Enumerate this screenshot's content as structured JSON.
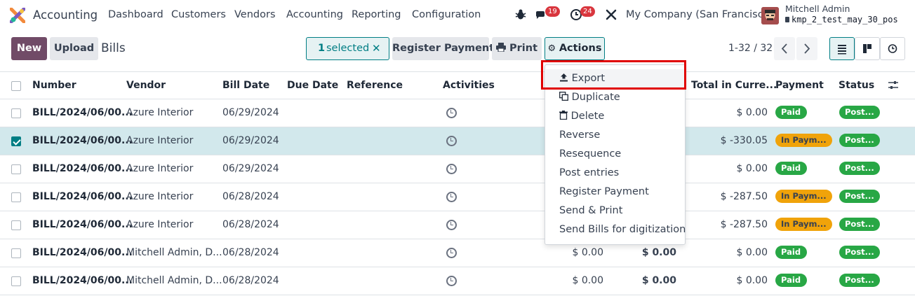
{
  "app": {
    "name": "Accounting"
  },
  "nav": {
    "menu": [
      "Dashboard",
      "Customers",
      "Vendors",
      "Accounting",
      "Reporting",
      "Configuration"
    ],
    "messages_badge": "19",
    "activities_badge": "24",
    "company": "My Company (San Francisco)",
    "user_name": "Mitchell Admin",
    "db_name": "kmp_2_test_may_30_pos"
  },
  "control": {
    "new_label": "New",
    "upload_label": "Upload",
    "breadcrumb": "Bills",
    "selected_count": "1",
    "selected_text": "selected",
    "register_payment_label": "Register Payment",
    "print_label": "Print",
    "actions_label": "Actions",
    "pager": "1-32 / 32"
  },
  "table": {
    "headers": {
      "number": "Number",
      "vendor": "Vendor",
      "bill_date": "Bill Date",
      "due_date": "Due Date",
      "reference": "Reference",
      "activities": "Activities",
      "total_currency": "Total in Curre...",
      "payment": "Payment",
      "status": "Status"
    },
    "rows": [
      {
        "number": "BILL/2024/06/00...",
        "vendor": "Azure Interior",
        "date": "06/29/2024",
        "tax": "",
        "total": "",
        "total_cur": "$ 0.00",
        "payment": "Paid",
        "status": "Post..."
      },
      {
        "number": "BILL/2024/06/00...",
        "vendor": "Azure Interior",
        "date": "06/29/2024",
        "tax": "",
        "total": "",
        "total_cur": "$ -330.05",
        "payment": "In Paym...",
        "status": "Post..."
      },
      {
        "number": "BILL/2024/06/00...",
        "vendor": "Azure Interior",
        "date": "06/29/2024",
        "tax": "",
        "total": "",
        "total_cur": "$ 0.00",
        "payment": "Paid",
        "status": "Post..."
      },
      {
        "number": "BILL/2024/06/00...",
        "vendor": "Azure Interior",
        "date": "06/28/2024",
        "tax": "",
        "total": "",
        "total_cur": "$ -287.50",
        "payment": "In Paym...",
        "status": "Post..."
      },
      {
        "number": "BILL/2024/06/00...",
        "vendor": "Azure Interior",
        "date": "06/28/2024",
        "tax": "",
        "total": "",
        "total_cur": "$ -287.50",
        "payment": "In Paym...",
        "status": "Post..."
      },
      {
        "number": "BILL/2024/06/00...",
        "vendor": "Mitchell Admin, D...",
        "date": "06/28/2024",
        "tax": "$ 0.00",
        "total": "$ 0.00",
        "total_cur": "$ 0.00",
        "payment": "Paid",
        "status": "Post..."
      },
      {
        "number": "BILL/2024/06/00...",
        "vendor": "Mitchell Admin, D...",
        "date": "06/28/2024",
        "tax": "$ 0.00",
        "total": "$ 0.00",
        "total_cur": "$ 0.00",
        "payment": "Paid",
        "status": "Post..."
      }
    ]
  },
  "actions_menu": [
    "Export",
    "Duplicate",
    "Delete",
    "Reverse",
    "Resequence",
    "Post entries",
    "Register Payment",
    "Send & Print",
    "Send Bills for digitization"
  ],
  "colors": {
    "primary": "#714b67",
    "accent": "#017e84",
    "paid": "#28a745",
    "in_payment": "#f0a30a",
    "badge": "#d9363e",
    "highlight": "#e00000"
  }
}
